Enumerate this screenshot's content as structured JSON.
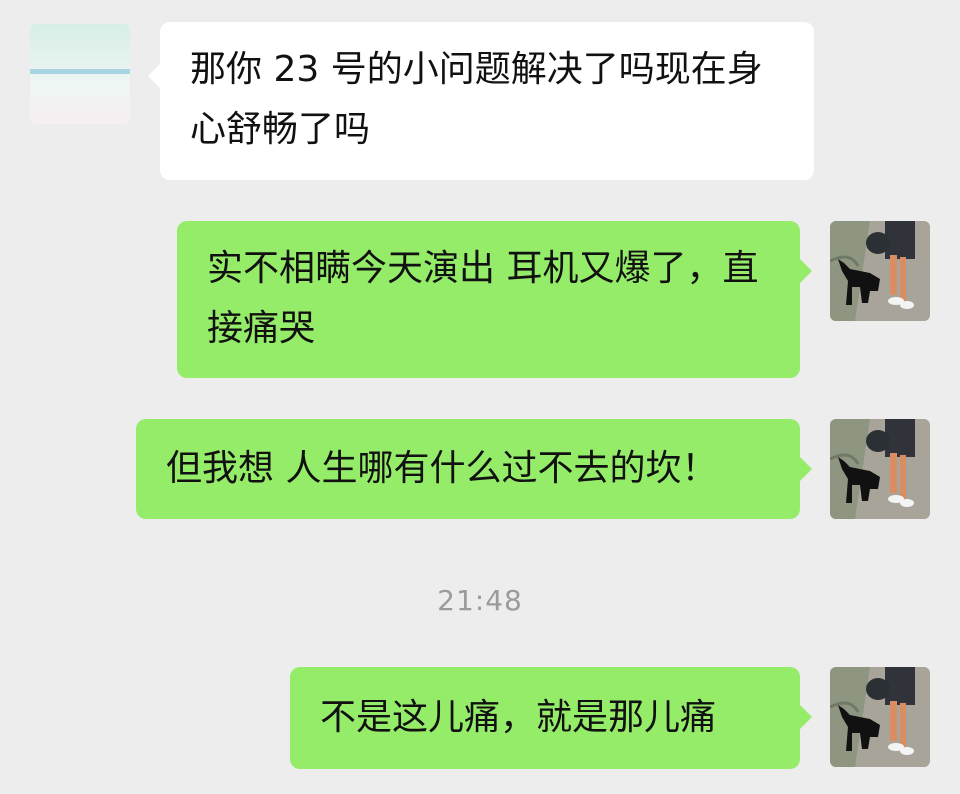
{
  "chat": {
    "messages": [
      {
        "sender": "contact",
        "text": "那你 23 号的小问题解决了吗现在身心舒畅了吗"
      },
      {
        "sender": "self",
        "text": "实不相瞒今天演出 耳机又爆了，直接痛哭"
      },
      {
        "sender": "self",
        "text": "但我想 人生哪有什么过不去的坎！"
      },
      {
        "sender": "self",
        "text": "不是这儿痛，就是那儿痛"
      }
    ],
    "timestamp": "21:48"
  },
  "colors": {
    "background": "#ededed",
    "incoming_bubble": "#ffffff",
    "outgoing_bubble": "#95ec69",
    "timestamp_text": "#9b9b9b"
  },
  "icons": {
    "contact_avatar": "avatar-contact-icon",
    "self_avatar": "avatar-self-icon"
  }
}
